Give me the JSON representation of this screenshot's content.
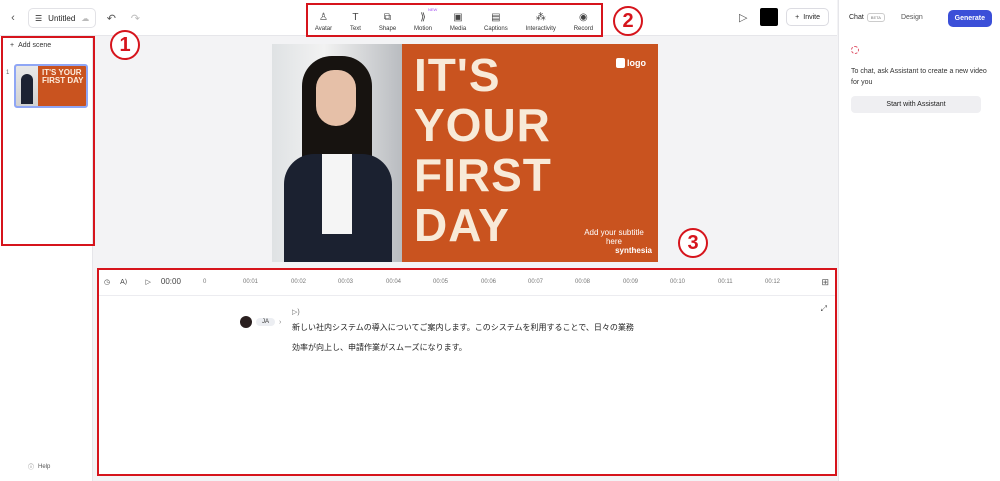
{
  "header": {
    "doc_title": "Untitled",
    "tools": [
      {
        "label": "Avatar",
        "icon": "avatar-icon"
      },
      {
        "label": "Text",
        "icon": "text-icon"
      },
      {
        "label": "Shape",
        "icon": "shape-icon"
      },
      {
        "label": "Motion",
        "icon": "motion-icon",
        "badge": "NEW"
      },
      {
        "label": "Media",
        "icon": "media-icon"
      },
      {
        "label": "Captions",
        "icon": "captions-icon"
      },
      {
        "label": "Interactivity",
        "icon": "interactivity-icon"
      },
      {
        "label": "Record",
        "icon": "record-icon"
      }
    ],
    "invite_label": "Invite",
    "swatch_color": "#000000"
  },
  "left_panel": {
    "add_scene_label": "Add scene",
    "scenes": [
      {
        "number": "1",
        "thumb_text": "IT'S YOUR FIRST DAY"
      }
    ],
    "help_label": "Help"
  },
  "canvas": {
    "headline": "IT'S YOUR FIRST DAY",
    "logo_text": "logo",
    "subtitle": "Add your subtitle here",
    "brand": "synthesia",
    "bg_color": "#c9531f"
  },
  "timeline": {
    "current_time": "00:00",
    "ticks": [
      "0",
      "00:01",
      "00:02",
      "00:03",
      "00:04",
      "00:05",
      "00:06",
      "00:07",
      "00:08",
      "00:09",
      "00:10",
      "00:11",
      "00:12"
    ]
  },
  "script": {
    "language": "JA",
    "text": "新しい社内システムの導入についてご案内します。このシステムを利用することで、日々の業務効率が向上し、申請作業がスムーズになります。"
  },
  "right_panel": {
    "tab_chat": "Chat",
    "beta_badge": "BETA",
    "tab_design": "Design",
    "generate_label": "Generate",
    "hint": "To chat, ask Assistant to create a new video for you",
    "start_label": "Start with Assistant"
  },
  "annotations": [
    "1",
    "2",
    "3"
  ],
  "colors": {
    "accent": "#3b4fd8",
    "annotation": "#d6141c"
  }
}
